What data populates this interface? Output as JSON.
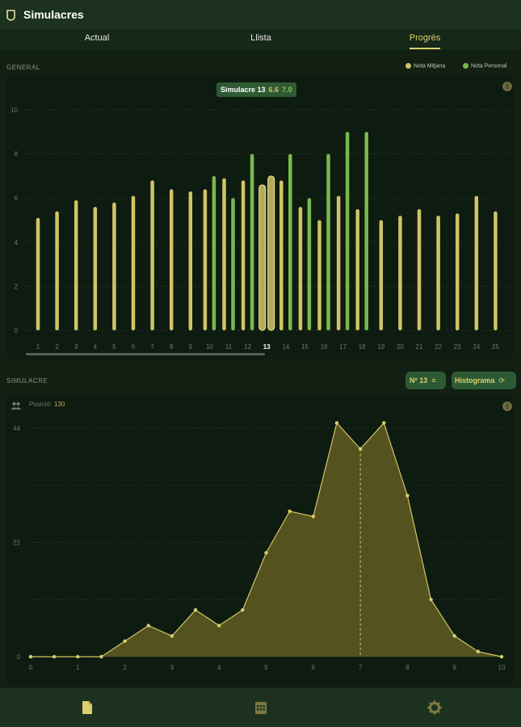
{
  "app": {
    "title": "Simulacres"
  },
  "tabs": [
    {
      "label": "Actual"
    },
    {
      "label": "Llista"
    },
    {
      "label": "Progrés"
    }
  ],
  "colors": {
    "accent": "#d9cf6c",
    "mitjana_bar": "#cfc465",
    "personal_bar": "#79b94f",
    "tab_active": "#d9cf6c"
  },
  "general": {
    "label": "GENERAL",
    "legend": [
      {
        "label": "Nota Mitjana",
        "color": "#cfc465"
      },
      {
        "label": "Nota Personal",
        "color": "#79b94f"
      }
    ],
    "tooltip": {
      "label": "Simulacre 13",
      "mitjana": "6.6",
      "personal": "7.0"
    },
    "chart_data": {
      "type": "bar",
      "title": "",
      "categories": [
        "1",
        "2",
        "3",
        "4",
        "5",
        "6",
        "7",
        "8",
        "9",
        "10",
        "11",
        "12",
        "13",
        "14",
        "15",
        "16",
        "17",
        "18",
        "19",
        "20",
        "21",
        "22",
        "23",
        "24",
        "25"
      ],
      "selected_category": "13",
      "ylim": [
        0,
        10
      ],
      "yticks": [
        0,
        2,
        4,
        6,
        8,
        10
      ],
      "grid": true,
      "series": [
        {
          "name": "Nota Mitjana",
          "values": [
            5.1,
            5.4,
            5.9,
            5.6,
            5.8,
            6.1,
            6.8,
            6.4,
            6.3,
            6.4,
            6.9,
            6.8,
            6.6,
            6.8,
            5.6,
            5.0,
            6.1,
            5.5,
            5.0,
            5.2,
            5.5,
            5.2,
            5.3,
            6.1,
            5.4
          ]
        },
        {
          "name": "Nota Personal",
          "values": [
            null,
            null,
            null,
            null,
            null,
            null,
            null,
            null,
            null,
            7.0,
            6.0,
            8.0,
            7.0,
            8.0,
            6.0,
            8.0,
            9.0,
            9.0,
            null,
            null,
            null,
            null,
            null,
            null,
            null
          ]
        }
      ]
    }
  },
  "simulacre": {
    "label": "SIMULACRE",
    "number_button": "Nº 13",
    "histogram_button": "Histograma",
    "position_label": "Posició:",
    "position_value": "130",
    "chart_data": {
      "type": "area",
      "title": "",
      "x": [
        0,
        0.5,
        1,
        1.5,
        2,
        2.5,
        3,
        3.5,
        4,
        4.5,
        5,
        5.5,
        6,
        6.5,
        7,
        7.5,
        8,
        8.5,
        9,
        9.5,
        10
      ],
      "values": [
        0,
        0,
        0,
        0,
        3,
        6,
        4,
        9,
        6,
        9,
        20,
        28,
        27,
        45,
        40,
        45,
        31,
        11,
        4,
        1,
        0
      ],
      "xlim": [
        0,
        10
      ],
      "ylim": [
        0,
        44
      ],
      "yticks": [
        0,
        22,
        44
      ],
      "xticks": [
        0,
        1,
        2,
        3,
        4,
        5,
        6,
        7,
        8,
        9,
        10
      ],
      "marker_x": 7,
      "grid": true
    }
  },
  "bottom_nav": [
    {
      "icon": "document-icon"
    },
    {
      "icon": "calendar-icon"
    },
    {
      "icon": "gear-icon"
    }
  ]
}
